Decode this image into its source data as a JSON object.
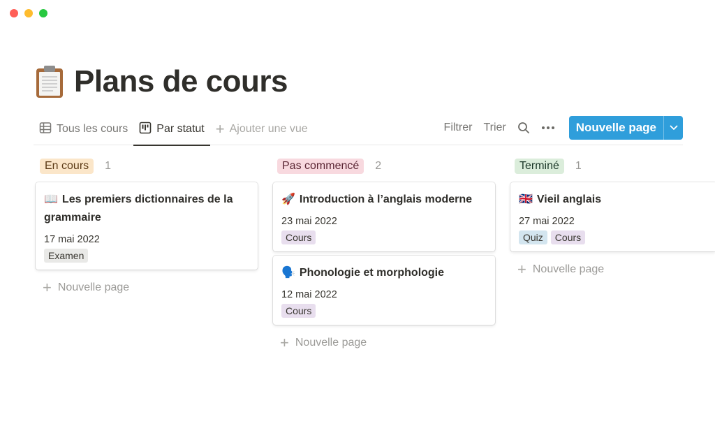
{
  "page": {
    "title": "Plans de cours",
    "icon": "clipboard-icon"
  },
  "views": {
    "tabs": [
      {
        "label": "Tous les cours",
        "icon": "table-icon",
        "active": false
      },
      {
        "label": "Par statut",
        "icon": "board-icon",
        "active": true
      }
    ],
    "add_view_label": "Ajouter une vue"
  },
  "toolbar": {
    "filter_label": "Filtrer",
    "sort_label": "Trier",
    "search_icon": "search-icon",
    "more_icon": "more-icon",
    "new_page_label": "Nouvelle page"
  },
  "board": {
    "new_page_label": "Nouvelle page",
    "columns": [
      {
        "status": "En cours",
        "count": "1",
        "status_bg": "#fbe6c9",
        "cards": [
          {
            "emoji": "📖",
            "title": "Les premiers dictionnaires de la grammaire",
            "date": "17 mai 2022",
            "tags": [
              "Examen"
            ]
          }
        ]
      },
      {
        "status": "Pas commencé",
        "count": "2",
        "status_bg": "#f8d9df",
        "cards": [
          {
            "emoji": "🚀",
            "title": "Introduction à l’anglais moderne",
            "date": "23 mai 2022",
            "tags": [
              "Cours"
            ]
          },
          {
            "emoji": "🗣️",
            "title": "Phonologie et morphologie",
            "date": "12 mai 2022",
            "tags": [
              "Cours"
            ]
          }
        ]
      },
      {
        "status": "Terminé",
        "count": "1",
        "status_bg": "#dbeddb",
        "cards": [
          {
            "emoji": "🇬🇧",
            "title": "Vieil anglais",
            "date": "27 mai 2022",
            "tags": [
              "Quiz",
              "Cours"
            ]
          }
        ]
      }
    ]
  },
  "tag_colors": {
    "Examen": "#e9e9e7",
    "Cours": "#e8deee",
    "Quiz": "#d3e5ef"
  },
  "colors": {
    "accent": "#2f9edb"
  }
}
